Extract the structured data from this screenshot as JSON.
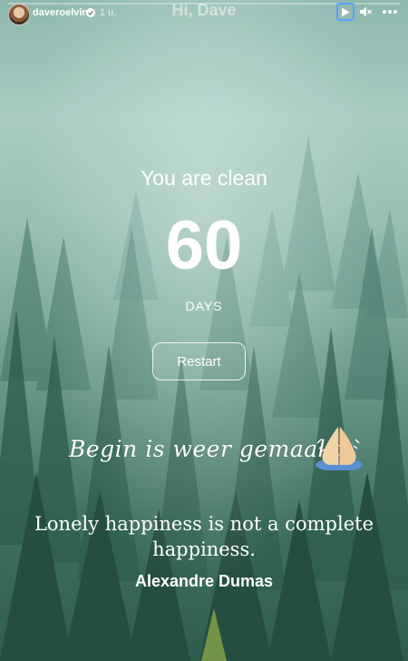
{
  "story": {
    "progress_fraction": 0.0,
    "username": "daveroelvink",
    "verified_icon": "verified-badge-icon",
    "time_ago": "1 u.",
    "greeting": "Hi, Dave",
    "controls": {
      "play_icon": "play-icon",
      "mute_icon": "mute-icon",
      "more_icon": "more-icon"
    },
    "accent_color": "#5aa0ff"
  },
  "counter": {
    "headline": "You are clean",
    "count": "60",
    "unit": "DAYS",
    "restart_label": "Restart"
  },
  "caption": {
    "script_text": "Begin is weer gemaakt",
    "emoji_icon": "folded-hands-icon"
  },
  "quote": {
    "text": "Lonely happiness is not a complete happiness.",
    "author": "Alexandre Dumas"
  }
}
